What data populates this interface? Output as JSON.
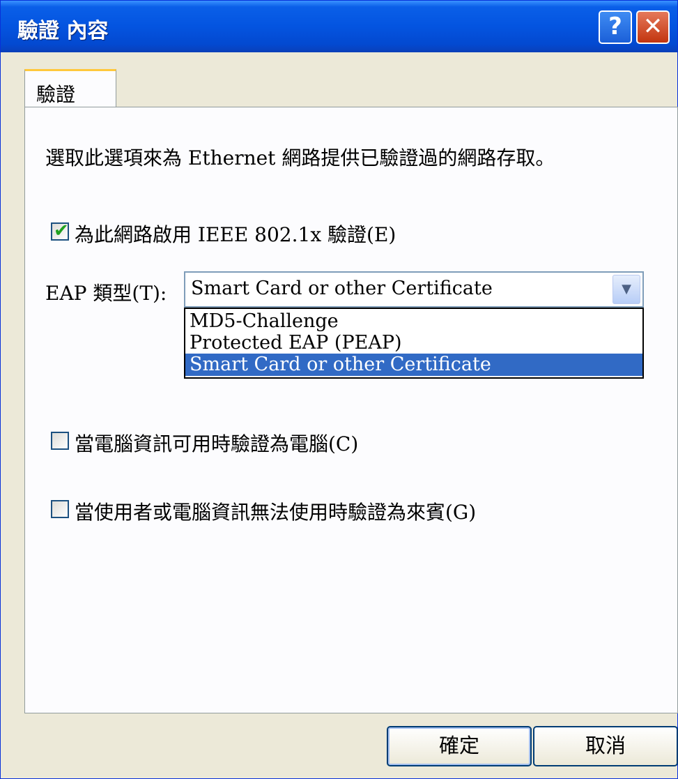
{
  "window": {
    "title": "驗證 內容",
    "help_label": "?",
    "close_label": "✕"
  },
  "tab": {
    "label": "驗證"
  },
  "description": "選取此選項來為 Ethernet 網路提供已驗證過的網路存取。",
  "enable_8021x": {
    "label": "為此網路啟用 IEEE 802.1x 驗證(E)",
    "checked": true
  },
  "eap": {
    "label": "EAP 類型(T):",
    "selected": "Smart Card or other Certificate",
    "options": [
      "MD5-Challenge",
      "Protected EAP (PEAP)",
      "Smart Card or other Certificate"
    ]
  },
  "auth_as_computer": {
    "label": "當電腦資訊可用時驗證為電腦(C)",
    "checked": false
  },
  "auth_as_guest": {
    "label": "當使用者或電腦資訊無法使用時驗證為來賓(G)",
    "checked": false
  },
  "buttons": {
    "ok": "確定",
    "cancel": "取消"
  },
  "icons": {
    "check": "✔",
    "dropdown": "chevron-down-icon"
  },
  "colors": {
    "title_bar": "#0454e0",
    "selection": "#316ac5",
    "tab_highlight": "#ffc83c"
  }
}
